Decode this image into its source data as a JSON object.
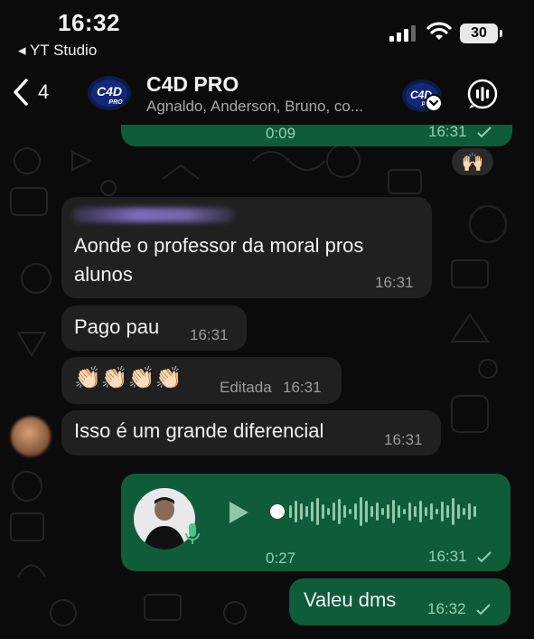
{
  "status_bar": {
    "time": "16:32",
    "back_app": "◂ YT Studio",
    "battery": "30"
  },
  "header": {
    "back_count": "4",
    "title": "C4D PRO",
    "members": "Agnaldo, Anderson, Bruno, co...",
    "avatar_logo": "C4D",
    "avatar_sub": "PRO"
  },
  "messages": {
    "prev_voice_duration": "0:09",
    "prev_voice_time": "16:31",
    "reaction": "🙌🏻",
    "msg1_line1": "Aonde o professor da moral pros",
    "msg1_line2": "alunos",
    "msg1_time": "16:31",
    "msg2_text": "Pago pau",
    "msg2_time": "16:31",
    "msg3_emoji": "👏🏻👏🏻👏🏻👏🏻",
    "msg3_edited": "Editada",
    "msg3_time": "16:31",
    "msg4_text": "Isso é um grande diferencial",
    "msg4_time": "16:31",
    "voice_duration": "0:27",
    "voice_time": "16:31",
    "msg5_text": "Valeu dms",
    "msg5_time": "16:32"
  },
  "colors": {
    "incoming_bubble": "#202020",
    "outgoing_bubble": "#0f5c3a",
    "accent_green": "#25d366"
  },
  "icons": [
    "chevron-left-icon",
    "signal-icon",
    "wifi-icon",
    "battery-icon",
    "call-icon",
    "play-icon",
    "mic-icon",
    "read-check-icon"
  ]
}
